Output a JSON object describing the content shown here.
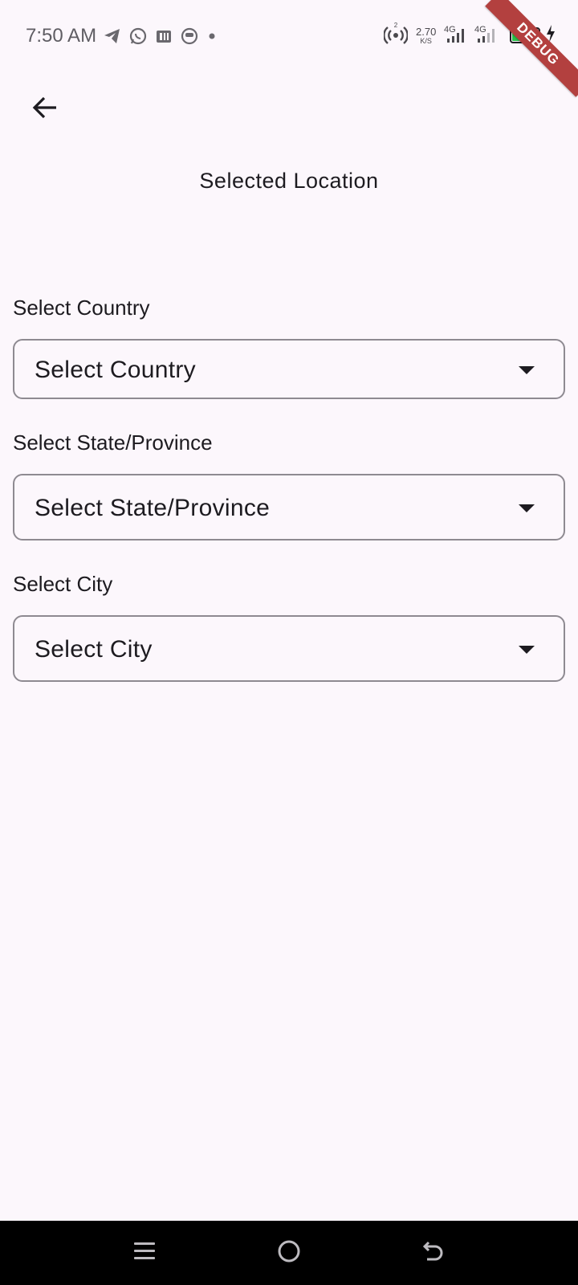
{
  "status_bar": {
    "time": "7:50 AM",
    "net_speed_value": "2.70",
    "net_speed_unit": "K/S",
    "network_1": "4G",
    "network_2": "4G",
    "battery_level": "59",
    "hotspot_badge": "2",
    "icons": [
      "telegram-icon",
      "whatsapp-icon",
      "parking-app-icon",
      "messenger-icon",
      "notification-dot-icon",
      "hotspot-icon",
      "signal-icon",
      "signal-icon",
      "battery-icon",
      "charging-icon"
    ]
  },
  "debug_banner": "DEBUG",
  "app_bar": {
    "back_icon": "arrow-back-icon",
    "title": "Selected Location"
  },
  "form": {
    "country": {
      "label": "Select Country",
      "value": "Select Country"
    },
    "state": {
      "label": "Select State/Province",
      "value": "Select State/Province"
    },
    "city": {
      "label": "Select City",
      "value": "Select City"
    }
  },
  "nav_bar": {
    "buttons": [
      "menu-icon",
      "home-icon",
      "back-icon"
    ]
  },
  "colors": {
    "background": "#fcf7fc",
    "text": "#1d1b20",
    "outline": "#8e8a91",
    "debug": "#b3403f",
    "battery": "#29c24b",
    "nav_bar": "#000000"
  }
}
